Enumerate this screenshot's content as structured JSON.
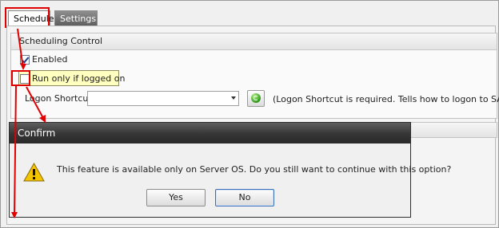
{
  "tabs": [
    {
      "label": "Schedule",
      "active": true
    },
    {
      "label": "Settings",
      "active": false
    }
  ],
  "scheduling_control": {
    "title": "Scheduling Control",
    "enabled": {
      "label": "Enabled",
      "checked": true
    },
    "run_logged_on": {
      "label": "Run only if logged on",
      "checked": false
    },
    "logon_shortcut": {
      "label": "Logon Shortcut",
      "value": "",
      "hint": "(Logon Shortcut is required. Tells how to logon to SAP)"
    }
  },
  "dialog": {
    "title": "Confirm",
    "message": "This feature is available only on Server OS. Do you still want to continue with this option?",
    "yes_label": "Yes",
    "no_label": "No",
    "icon": "warning-icon"
  },
  "colors": {
    "highlight": "#e00000",
    "tooltip_bg": "#ffffc0",
    "dialog_title_bg": "#353535"
  }
}
